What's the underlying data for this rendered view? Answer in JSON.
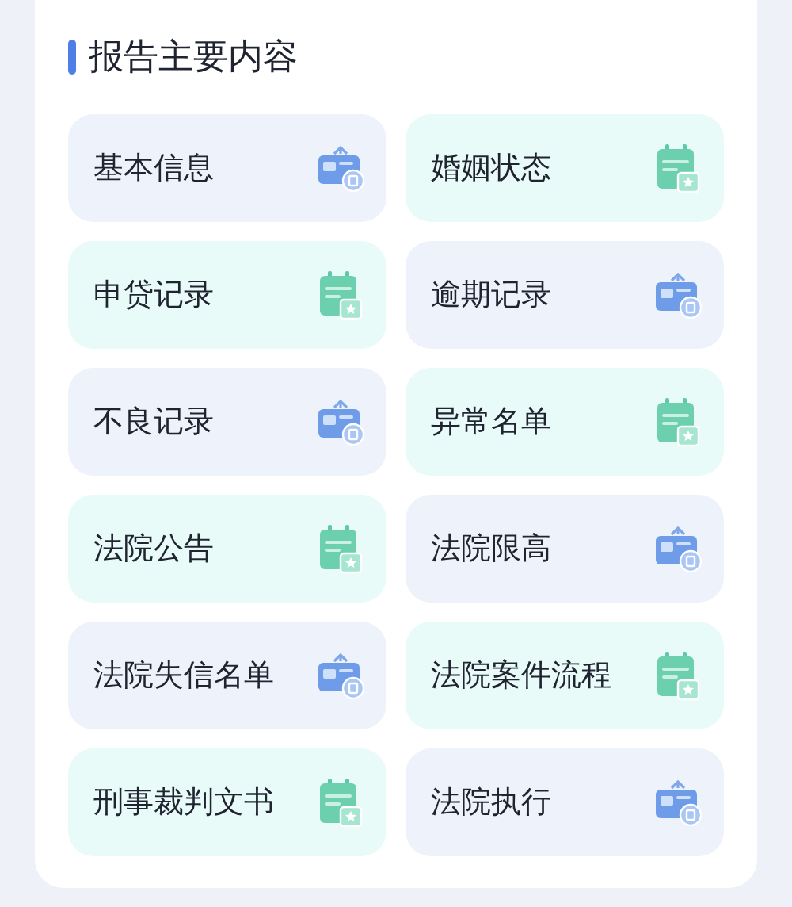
{
  "section": {
    "title": "报告主要内容"
  },
  "items": [
    {
      "label": "基本信息",
      "kind": "badge"
    },
    {
      "label": "婚姻状态",
      "kind": "calendar"
    },
    {
      "label": "申贷记录",
      "kind": "calendar"
    },
    {
      "label": "逾期记录",
      "kind": "badge"
    },
    {
      "label": "不良记录",
      "kind": "badge"
    },
    {
      "label": "异常名单",
      "kind": "calendar"
    },
    {
      "label": "法院公告",
      "kind": "calendar"
    },
    {
      "label": "法院限高",
      "kind": "badge"
    },
    {
      "label": "法院失信名单",
      "kind": "badge"
    },
    {
      "label": "法院案件流程",
      "kind": "calendar"
    },
    {
      "label": "刑事裁判文书",
      "kind": "calendar"
    },
    {
      "label": "法院执行",
      "kind": "badge"
    }
  ]
}
